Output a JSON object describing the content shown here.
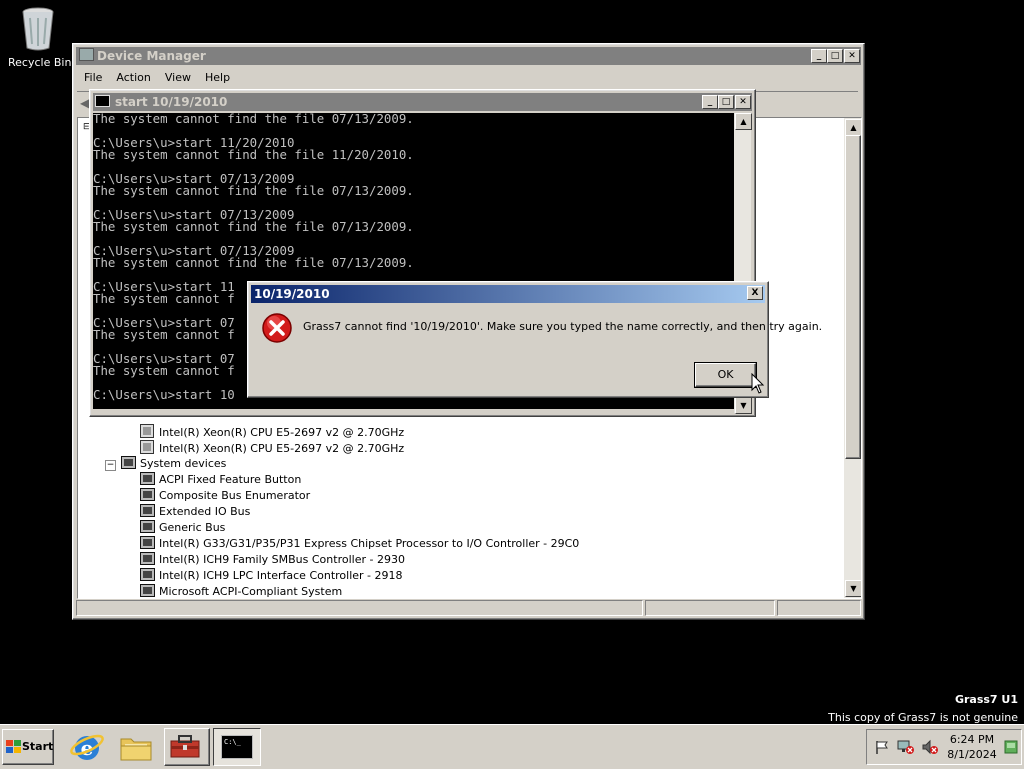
{
  "desktop": {
    "recycle_bin_label": "Recycle Bin",
    "watermark_title": "Grass7 U1",
    "watermark_notice": "This copy of Grass7 is not genuine"
  },
  "device_manager": {
    "title": "Device Manager",
    "menu": [
      "File",
      "Action",
      "View",
      "Help"
    ],
    "tree": [
      {
        "label": "Intel(R) Xeon(R) CPU E5-2697 v2 @ 2.70GHz",
        "kind": "cpu"
      },
      {
        "label": "Intel(R) Xeon(R) CPU E5-2697 v2 @ 2.70GHz",
        "kind": "cpu"
      },
      {
        "label": "System devices",
        "kind": "category"
      },
      {
        "label": "ACPI Fixed Feature Button",
        "kind": "device"
      },
      {
        "label": "Composite Bus Enumerator",
        "kind": "device"
      },
      {
        "label": "Extended IO Bus",
        "kind": "device"
      },
      {
        "label": "Generic Bus",
        "kind": "device"
      },
      {
        "label": "Intel(R) G33/G31/P35/P31 Express Chipset Processor to I/O Controller - 29C0",
        "kind": "device"
      },
      {
        "label": "Intel(R) ICH9 Family SMBus Controller - 2930",
        "kind": "device"
      },
      {
        "label": "Intel(R) ICH9 LPC Interface Controller - 2918",
        "kind": "device"
      },
      {
        "label": "Microsoft ACPI-Compliant System",
        "kind": "device"
      }
    ]
  },
  "console": {
    "title": "start  10/19/2010",
    "text": "The system cannot find the file 07/13/2009.\n\nC:\\Users\\u>start 11/20/2010\nThe system cannot find the file 11/20/2010.\n\nC:\\Users\\u>start 07/13/2009\nThe system cannot find the file 07/13/2009.\n\nC:\\Users\\u>start 07/13/2009\nThe system cannot find the file 07/13/2009.\n\nC:\\Users\\u>start 07/13/2009\nThe system cannot find the file 07/13/2009.\n\nC:\\Users\\u>start 11\nThe system cannot f\n\nC:\\Users\\u>start 07\nThe system cannot f\n\nC:\\Users\\u>start 07\nThe system cannot f\n\nC:\\Users\\u>start 10"
  },
  "dialog": {
    "title": "10/19/2010",
    "message": "Grass7 cannot find '10/19/2010'. Make sure you typed the name correctly, and then try again.",
    "ok_label": "OK",
    "close_label": "X"
  },
  "taskbar": {
    "start_label": "Start",
    "clock_time": "6:24 PM",
    "clock_date": "8/1/2024",
    "console_button_text": "C:\\_"
  }
}
